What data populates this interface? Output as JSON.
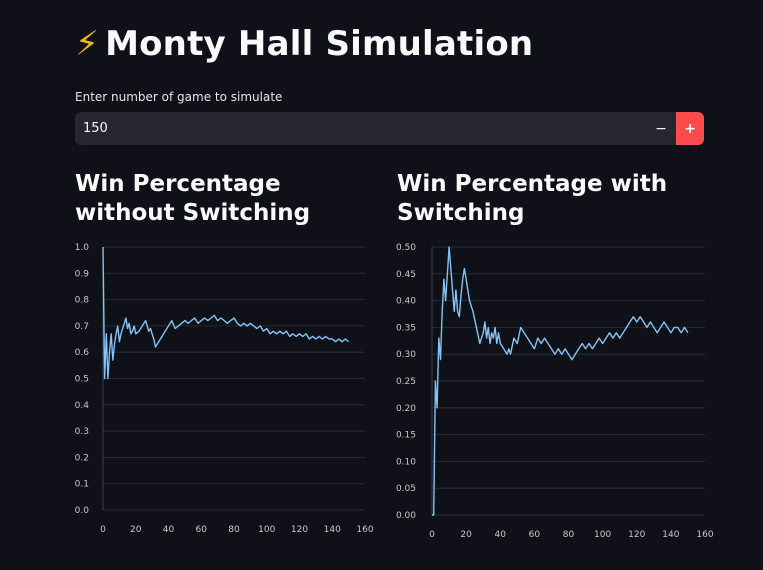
{
  "header": {
    "icon": "lightning-bolt-icon",
    "icon_glyph": "⚡",
    "title": "Monty Hall Simulation"
  },
  "input": {
    "label": "Enter number of game to simulate",
    "value": "150",
    "minus_label": "−",
    "plus_label": "+"
  },
  "colors": {
    "background": "#0e1117",
    "line": "#84c3f5",
    "accent": "#ff4b4b",
    "grid": "#262a33"
  },
  "chart_data": [
    {
      "type": "line",
      "title": "Win Percentage without Switching",
      "xlim": [
        0,
        160
      ],
      "ylim": [
        0,
        1.0
      ],
      "x_ticks": [
        "0",
        "20",
        "40",
        "60",
        "80",
        "100",
        "120",
        "140",
        "160"
      ],
      "y_ticks": [
        "0.0",
        "0.1",
        "0.2",
        "0.3",
        "0.4",
        "0.5",
        "0.6",
        "0.7",
        "0.8",
        "0.9",
        "1.0"
      ],
      "grid": "horizontal",
      "series": [
        {
          "points": [
            [
              0,
              1.0
            ],
            [
              1,
              0.5
            ],
            [
              2,
              0.67
            ],
            [
              3,
              0.5
            ],
            [
              4,
              0.6
            ],
            [
              5,
              0.67
            ],
            [
              6,
              0.57
            ],
            [
              7,
              0.63
            ],
            [
              8,
              0.67
            ],
            [
              9,
              0.7
            ],
            [
              10,
              0.64
            ],
            [
              11,
              0.67
            ],
            [
              12,
              0.69
            ],
            [
              13,
              0.71
            ],
            [
              14,
              0.73
            ],
            [
              15,
              0.69
            ],
            [
              16,
              0.71
            ],
            [
              17,
              0.67
            ],
            [
              18,
              0.68
            ],
            [
              19,
              0.7
            ],
            [
              20,
              0.67
            ],
            [
              22,
              0.68
            ],
            [
              24,
              0.7
            ],
            [
              26,
              0.72
            ],
            [
              27,
              0.7
            ],
            [
              28,
              0.68
            ],
            [
              29,
              0.69
            ],
            [
              30,
              0.67
            ],
            [
              31,
              0.65
            ],
            [
              32,
              0.62
            ],
            [
              34,
              0.64
            ],
            [
              36,
              0.66
            ],
            [
              38,
              0.68
            ],
            [
              40,
              0.7
            ],
            [
              42,
              0.72
            ],
            [
              44,
              0.69
            ],
            [
              46,
              0.7
            ],
            [
              48,
              0.71
            ],
            [
              50,
              0.72
            ],
            [
              52,
              0.71
            ],
            [
              54,
              0.72
            ],
            [
              56,
              0.73
            ],
            [
              58,
              0.71
            ],
            [
              60,
              0.72
            ],
            [
              62,
              0.73
            ],
            [
              64,
              0.72
            ],
            [
              66,
              0.73
            ],
            [
              68,
              0.74
            ],
            [
              70,
              0.72
            ],
            [
              72,
              0.73
            ],
            [
              74,
              0.72
            ],
            [
              76,
              0.71
            ],
            [
              78,
              0.72
            ],
            [
              80,
              0.73
            ],
            [
              82,
              0.71
            ],
            [
              84,
              0.7
            ],
            [
              86,
              0.71
            ],
            [
              88,
              0.7
            ],
            [
              90,
              0.71
            ],
            [
              92,
              0.7
            ],
            [
              94,
              0.69
            ],
            [
              96,
              0.7
            ],
            [
              98,
              0.68
            ],
            [
              100,
              0.69
            ],
            [
              102,
              0.67
            ],
            [
              104,
              0.68
            ],
            [
              106,
              0.67
            ],
            [
              108,
              0.68
            ],
            [
              110,
              0.67
            ],
            [
              112,
              0.68
            ],
            [
              114,
              0.66
            ],
            [
              116,
              0.67
            ],
            [
              118,
              0.66
            ],
            [
              120,
              0.67
            ],
            [
              122,
              0.66
            ],
            [
              124,
              0.67
            ],
            [
              126,
              0.65
            ],
            [
              128,
              0.66
            ],
            [
              130,
              0.65
            ],
            [
              132,
              0.66
            ],
            [
              134,
              0.65
            ],
            [
              136,
              0.66
            ],
            [
              138,
              0.65
            ],
            [
              140,
              0.65
            ],
            [
              142,
              0.64
            ],
            [
              144,
              0.65
            ],
            [
              146,
              0.64
            ],
            [
              148,
              0.65
            ],
            [
              150,
              0.64
            ]
          ]
        }
      ]
    },
    {
      "type": "line",
      "title": "Win Percentage with Switching",
      "xlim": [
        0,
        160
      ],
      "ylim": [
        0,
        0.5
      ],
      "x_ticks": [
        "0",
        "20",
        "40",
        "60",
        "80",
        "100",
        "120",
        "140",
        "160"
      ],
      "y_ticks": [
        "0.00",
        "0.05",
        "0.10",
        "0.15",
        "0.20",
        "0.25",
        "0.30",
        "0.35",
        "0.40",
        "0.45",
        "0.50"
      ],
      "grid": "horizontal",
      "series": [
        {
          "points": [
            [
              0,
              0.0
            ],
            [
              1,
              0.0
            ],
            [
              2,
              0.25
            ],
            [
              3,
              0.2
            ],
            [
              4,
              0.33
            ],
            [
              5,
              0.29
            ],
            [
              6,
              0.38
            ],
            [
              7,
              0.44
            ],
            [
              8,
              0.4
            ],
            [
              9,
              0.45
            ],
            [
              10,
              0.5
            ],
            [
              11,
              0.46
            ],
            [
              12,
              0.42
            ],
            [
              13,
              0.38
            ],
            [
              14,
              0.42
            ],
            [
              15,
              0.38
            ],
            [
              16,
              0.37
            ],
            [
              17,
              0.41
            ],
            [
              18,
              0.44
            ],
            [
              19,
              0.46
            ],
            [
              20,
              0.44
            ],
            [
              21,
              0.42
            ],
            [
              22,
              0.4
            ],
            [
              24,
              0.38
            ],
            [
              26,
              0.35
            ],
            [
              28,
              0.32
            ],
            [
              30,
              0.34
            ],
            [
              31,
              0.36
            ],
            [
              32,
              0.33
            ],
            [
              33,
              0.35
            ],
            [
              34,
              0.32
            ],
            [
              35,
              0.34
            ],
            [
              36,
              0.33
            ],
            [
              37,
              0.35
            ],
            [
              38,
              0.32
            ],
            [
              39,
              0.34
            ],
            [
              40,
              0.32
            ],
            [
              42,
              0.31
            ],
            [
              44,
              0.3
            ],
            [
              45,
              0.31
            ],
            [
              46,
              0.3
            ],
            [
              48,
              0.33
            ],
            [
              50,
              0.32
            ],
            [
              52,
              0.35
            ],
            [
              54,
              0.34
            ],
            [
              56,
              0.33
            ],
            [
              58,
              0.32
            ],
            [
              60,
              0.31
            ],
            [
              62,
              0.33
            ],
            [
              64,
              0.32
            ],
            [
              66,
              0.33
            ],
            [
              68,
              0.32
            ],
            [
              70,
              0.31
            ],
            [
              72,
              0.3
            ],
            [
              74,
              0.31
            ],
            [
              76,
              0.3
            ],
            [
              78,
              0.31
            ],
            [
              80,
              0.3
            ],
            [
              82,
              0.29
            ],
            [
              84,
              0.3
            ],
            [
              86,
              0.31
            ],
            [
              88,
              0.32
            ],
            [
              90,
              0.31
            ],
            [
              92,
              0.32
            ],
            [
              94,
              0.31
            ],
            [
              96,
              0.32
            ],
            [
              98,
              0.33
            ],
            [
              100,
              0.32
            ],
            [
              102,
              0.33
            ],
            [
              104,
              0.34
            ],
            [
              106,
              0.33
            ],
            [
              108,
              0.34
            ],
            [
              110,
              0.33
            ],
            [
              112,
              0.34
            ],
            [
              114,
              0.35
            ],
            [
              116,
              0.36
            ],
            [
              118,
              0.37
            ],
            [
              120,
              0.36
            ],
            [
              122,
              0.37
            ],
            [
              124,
              0.36
            ],
            [
              126,
              0.35
            ],
            [
              128,
              0.36
            ],
            [
              130,
              0.35
            ],
            [
              132,
              0.34
            ],
            [
              134,
              0.35
            ],
            [
              136,
              0.36
            ],
            [
              138,
              0.35
            ],
            [
              140,
              0.34
            ],
            [
              142,
              0.35
            ],
            [
              144,
              0.35
            ],
            [
              146,
              0.34
            ],
            [
              148,
              0.35
            ],
            [
              150,
              0.34
            ]
          ]
        }
      ]
    }
  ]
}
